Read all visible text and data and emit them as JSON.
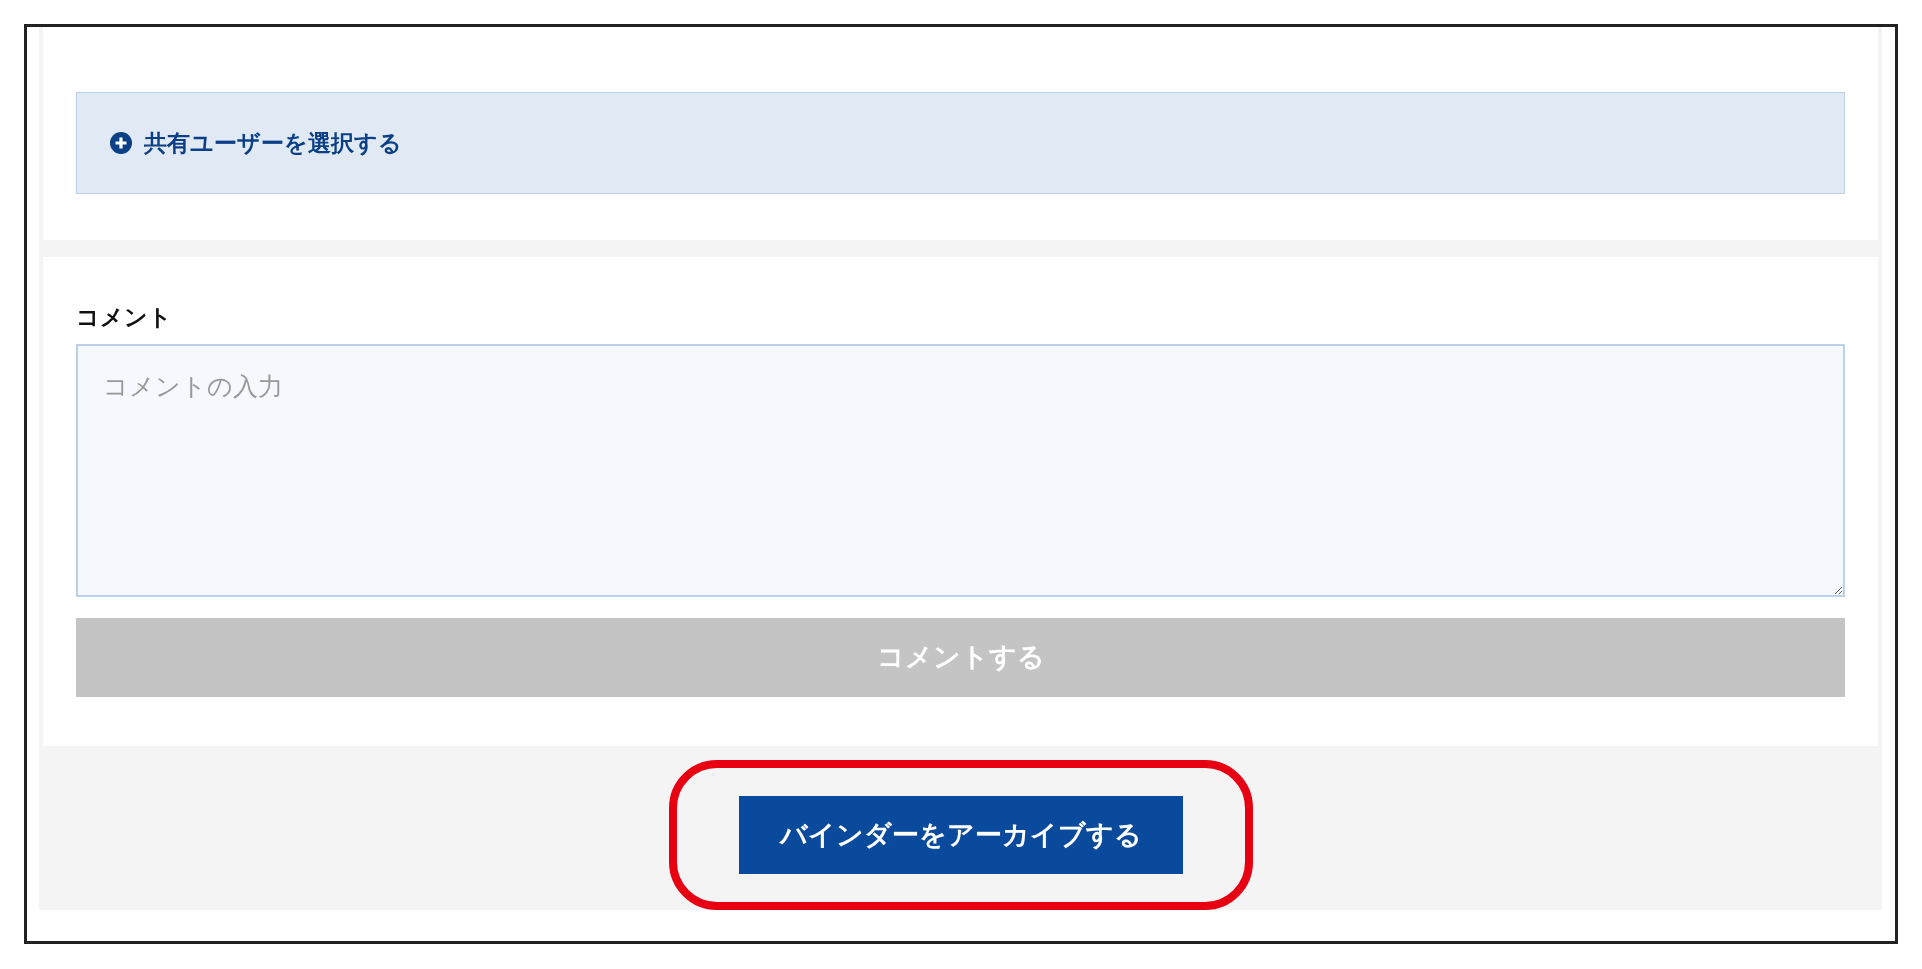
{
  "share_panel": {
    "add_users_button": "共有ユーザーを選択する"
  },
  "comment": {
    "label": "コメント",
    "placeholder": "コメントの入力",
    "submit_button": {
      "label": "コメントする",
      "disabled": true
    }
  },
  "archive_button": {
    "label": "バインダーをアーカイブする",
    "highlighted": true
  }
}
